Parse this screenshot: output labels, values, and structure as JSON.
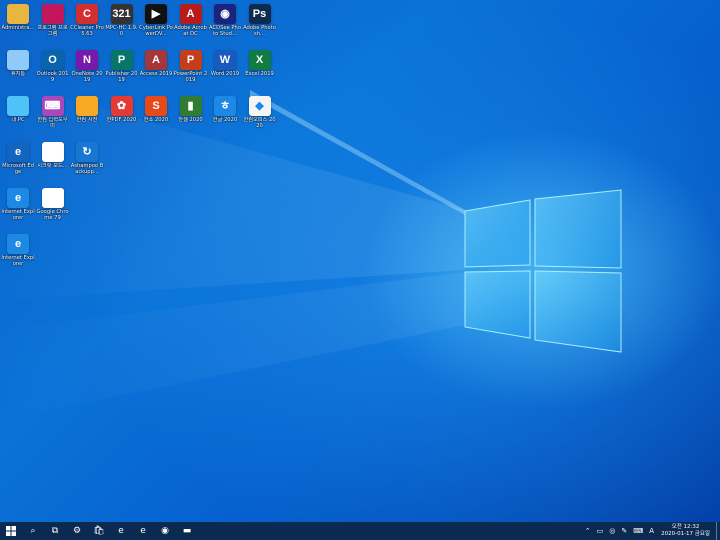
{
  "desktop_icons": [
    {
      "label": "Administra...",
      "icon": "user-folder-icon",
      "color": "#e8b640",
      "glyph": "",
      "col": 0,
      "row": 0
    },
    {
      "label": "프로그램 프로그램",
      "icon": "tv-icon",
      "color": "#c2185b",
      "glyph": "",
      "col": 1,
      "row": 0
    },
    {
      "label": "CCleaner Pro 5.63",
      "icon": "ccleaner-icon",
      "color": "#d32f2f",
      "glyph": "C",
      "col": 2,
      "row": 0
    },
    {
      "label": "MPC-HC 1.9.0",
      "icon": "media-player-icon",
      "color": "#333333",
      "glyph": "321",
      "col": 3,
      "row": 0
    },
    {
      "label": "CyberLink PowerDV...",
      "icon": "powerdvd-icon",
      "color": "#111111",
      "glyph": "▶",
      "col": 4,
      "row": 0
    },
    {
      "label": "Adobe Acrobat DC",
      "icon": "acrobat-icon",
      "color": "#b71c1c",
      "glyph": "A",
      "col": 5,
      "row": 0
    },
    {
      "label": "ACDSee Photo Stud...",
      "icon": "acdsee-icon",
      "color": "#1a237e",
      "glyph": "◉",
      "col": 6,
      "row": 0
    },
    {
      "label": "Adobe Photosh...",
      "icon": "photoshop-icon",
      "color": "#0d2b4e",
      "glyph": "Ps",
      "col": 7,
      "row": 0
    },
    {
      "label": "휴지통",
      "icon": "recycle-bin-icon",
      "color": "#90caf9",
      "glyph": "",
      "col": 0,
      "row": 1
    },
    {
      "label": "Outlook 2019",
      "icon": "outlook-icon",
      "color": "#0a64ad",
      "glyph": "O",
      "col": 1,
      "row": 1
    },
    {
      "label": "OneNote 2019",
      "icon": "onenote-icon",
      "color": "#7719aa",
      "glyph": "N",
      "col": 2,
      "row": 1
    },
    {
      "label": "Publisher 2019",
      "icon": "publisher-icon",
      "color": "#077568",
      "glyph": "P",
      "col": 3,
      "row": 1
    },
    {
      "label": "Access 2019",
      "icon": "access-icon",
      "color": "#a4373a",
      "glyph": "A",
      "col": 4,
      "row": 1
    },
    {
      "label": "PowerPoint 2019",
      "icon": "powerpoint-icon",
      "color": "#c43e1c",
      "glyph": "P",
      "col": 5,
      "row": 1
    },
    {
      "label": "Word 2019",
      "icon": "word-icon",
      "color": "#185abd",
      "glyph": "W",
      "col": 6,
      "row": 1
    },
    {
      "label": "Excel 2019",
      "icon": "excel-icon",
      "color": "#107c41",
      "glyph": "X",
      "col": 7,
      "row": 1
    },
    {
      "label": "내 PC",
      "icon": "this-pc-icon",
      "color": "#4fc3f7",
      "glyph": "",
      "col": 0,
      "row": 2
    },
    {
      "label": "한컴 입력도우미",
      "icon": "keyboard-app-icon",
      "color": "#ab47bc",
      "glyph": "⌨",
      "col": 1,
      "row": 2
    },
    {
      "label": "한컴 사전",
      "icon": "dictionary-icon",
      "color": "#f9a825",
      "glyph": "",
      "col": 2,
      "row": 2
    },
    {
      "label": "한PDF 2020",
      "icon": "hancom-pdf-icon",
      "color": "#e53935",
      "glyph": "✿",
      "col": 3,
      "row": 2
    },
    {
      "label": "한쇼 2020",
      "icon": "hanshow-icon",
      "color": "#e64a19",
      "glyph": "S",
      "col": 4,
      "row": 2
    },
    {
      "label": "한셀 2020",
      "icon": "hancell-icon",
      "color": "#2e7d32",
      "glyph": "▮",
      "col": 5,
      "row": 2
    },
    {
      "label": "한글 2020",
      "icon": "hangul-icon",
      "color": "#1e88e5",
      "glyph": "ㅎ",
      "col": 6,
      "row": 2
    },
    {
      "label": "한컴오피스 2020",
      "icon": "hancom-office-icon",
      "color": "#f5f5f5",
      "glyph": "◆",
      "col": 7,
      "row": 2
    },
    {
      "label": "Microsoft Edge",
      "icon": "edge-legacy-icon",
      "color": "#1565c0",
      "glyph": "e",
      "col": 0,
      "row": 3
    },
    {
      "label": "시크릿 모드...",
      "icon": "chrome-incognito-icon",
      "color": "#ffffff",
      "glyph": "",
      "col": 1,
      "row": 3
    },
    {
      "label": "Ashampoo Backupp...",
      "icon": "backup-icon",
      "color": "#1976d2",
      "glyph": "↻",
      "col": 2,
      "row": 3
    },
    {
      "label": "Internet Explorer",
      "icon": "ie-icon",
      "color": "#1e88e5",
      "glyph": "e",
      "col": 0,
      "row": 4
    },
    {
      "label": "Google Chrome 79",
      "icon": "chrome-icon",
      "color": "#ffffff",
      "glyph": "",
      "col": 1,
      "row": 4
    },
    {
      "label": "Internet Explorer",
      "icon": "ie-icon",
      "color": "#1e88e5",
      "glyph": "e",
      "col": 0,
      "row": 5
    }
  ],
  "taskbar": {
    "start_icon": "windows-start-icon",
    "items": [
      {
        "name": "search-icon",
        "glyph": "⌕"
      },
      {
        "name": "task-view-icon",
        "glyph": "⧉"
      },
      {
        "name": "settings-icon",
        "glyph": "⚙"
      },
      {
        "name": "store-icon",
        "glyph": "🛍"
      },
      {
        "name": "edge-icon",
        "glyph": "e"
      },
      {
        "name": "ie-icon",
        "glyph": "e"
      },
      {
        "name": "chrome-icon",
        "glyph": "◉"
      },
      {
        "name": "file-explorer-icon",
        "glyph": "▬"
      }
    ]
  },
  "tray": {
    "icons": [
      "chevron-up-icon",
      "usb-icon",
      "network-icon",
      "pen-icon",
      "keyboard-icon"
    ],
    "ime": "A",
    "time": "오전 12:32",
    "date": "2020-01-17 금요일"
  },
  "colors": {
    "taskbar": "#0a2a52",
    "desktop_base": "#0a73d8"
  }
}
